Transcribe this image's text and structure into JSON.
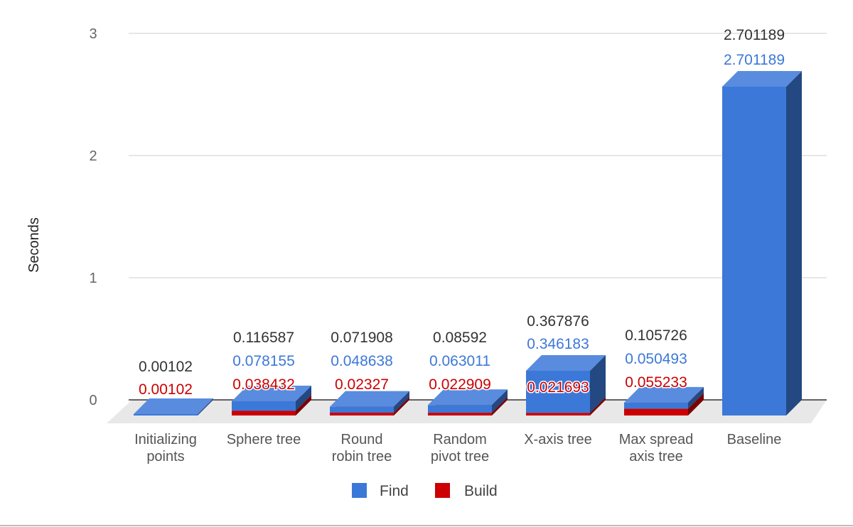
{
  "chart_data": {
    "type": "bar",
    "stacked": true,
    "three_d": true,
    "ylabel": "Seconds",
    "xlabel": "",
    "ylim": [
      0,
      3
    ],
    "yticks": [
      "0",
      "1",
      "2",
      "3"
    ],
    "grid": true,
    "legend_position": "bottom",
    "categories": [
      [
        "Initializing",
        "points"
      ],
      [
        "Sphere tree"
      ],
      [
        "Round",
        "robin tree"
      ],
      [
        "Random",
        "pivot tree"
      ],
      [
        "X-axis tree"
      ],
      [
        "Max spread",
        "axis tree"
      ],
      [
        "Baseline"
      ]
    ],
    "series": [
      {
        "name": "Build",
        "color": "#cc0000",
        "values": [
          0,
          0.038432,
          0.02327,
          0.022909,
          0.021693,
          0.055233,
          0
        ],
        "labels": [
          "0.00102",
          "0.038432",
          "0.02327",
          "0.022909",
          "0.021693",
          "0.055233",
          ""
        ]
      },
      {
        "name": "Find",
        "color": "#3c78d8",
        "values": [
          0.00102,
          0.078155,
          0.048638,
          0.063011,
          0.346183,
          0.050493,
          2.701189
        ],
        "labels": [
          "",
          "0.078155",
          "0.048638",
          "0.063011",
          "0.346183",
          "0.050493",
          "2.701189"
        ]
      }
    ],
    "totals": [
      "0.00102",
      "0.116587",
      "0.071908",
      "0.08592",
      "0.367876",
      "0.105726",
      "2.701189"
    ],
    "legend": [
      {
        "name": "Find",
        "color": "#3c78d8"
      },
      {
        "name": "Build",
        "color": "#cc0000"
      }
    ]
  }
}
